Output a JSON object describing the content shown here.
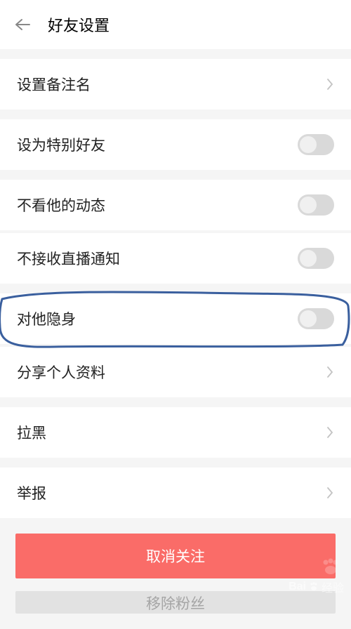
{
  "header": {
    "title": "好友设置"
  },
  "items": {
    "remark": {
      "label": "设置备注名"
    },
    "special": {
      "label": "设为特别好友"
    },
    "hideFeed": {
      "label": "不看他的动态"
    },
    "noLive": {
      "label": "不接收直播通知"
    },
    "invisible": {
      "label": "对他隐身"
    },
    "shareProfile": {
      "label": "分享个人资料"
    },
    "block": {
      "label": "拉黑"
    },
    "report": {
      "label": "举报"
    }
  },
  "actions": {
    "unfollow": "取消关注",
    "removeFan": "移除粉丝"
  },
  "watermark": {
    "brand": "Bai",
    "brand2": "经验"
  }
}
